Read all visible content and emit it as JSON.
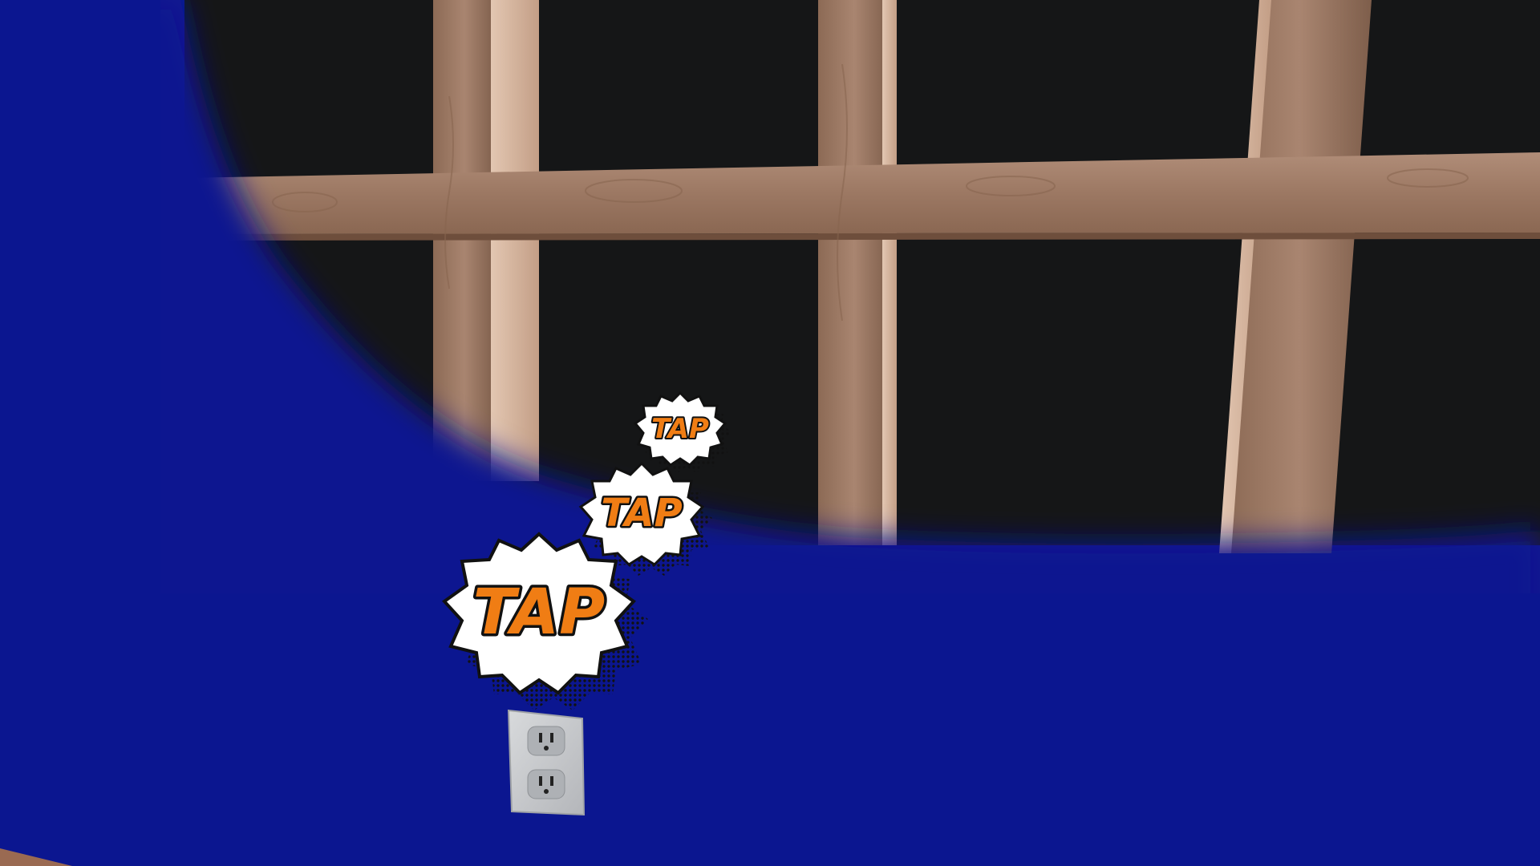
{
  "scene": {
    "type": "3d-game-view",
    "description_tags": [
      "window",
      "wooden-frame",
      "blue-wall",
      "wall-outlet",
      "comic-sound-effects"
    ]
  },
  "colors": {
    "wall_blue": "#0b1690",
    "wall_blue_light": "#0f1ea0",
    "night_glass": "#151617",
    "wood_mid": "#9a7660",
    "wood_light": "#c6a28a",
    "wood_dark": "#6e4e3c",
    "outlet_plate": "#c9cbce",
    "tap_fill": "#f07d14",
    "tap_outline": "#111111",
    "bubble_fill": "#ffffff"
  },
  "sound_effects": [
    {
      "text": "TAP",
      "size": "small"
    },
    {
      "text": "TAP",
      "size": "medium"
    },
    {
      "text": "TAP",
      "size": "large"
    }
  ],
  "icons": {
    "outlet": "wall-outlet-icon"
  }
}
